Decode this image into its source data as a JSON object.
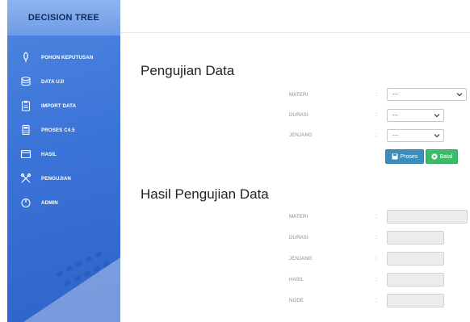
{
  "sidebar": {
    "brand": "DECISION TREE",
    "items": [
      {
        "label": "POHON KEPUTUSAN",
        "icon": "tree-icon"
      },
      {
        "label": "DATA UJI",
        "icon": "database-icon"
      },
      {
        "label": "IMPORT DATA",
        "icon": "clipboard-icon"
      },
      {
        "label": "PROSES C4.5",
        "icon": "calculator-icon"
      },
      {
        "label": "HASIL",
        "icon": "window-icon"
      },
      {
        "label": "PENGUJIAN",
        "icon": "tools-icon"
      },
      {
        "label": "ADMIN",
        "icon": "power-icon"
      }
    ]
  },
  "pengujian": {
    "title": "Pengujian Data",
    "fields": [
      {
        "label": "MATERI",
        "value": "---"
      },
      {
        "label": "DURASI",
        "value": "---"
      },
      {
        "label": "JENJANG",
        "value": "---"
      }
    ],
    "colon": ":",
    "proses_label": "Proses",
    "batal_label": "Batal"
  },
  "hasil": {
    "title": "Hasil Pengujian Data",
    "fields": [
      {
        "label": "MATERI",
        "value": ""
      },
      {
        "label": "DURASI",
        "value": ""
      },
      {
        "label": "JENJANG",
        "value": ""
      },
      {
        "label": "HASIL",
        "value": ""
      },
      {
        "label": "NODE",
        "value": ""
      }
    ],
    "colon": ":"
  },
  "colors": {
    "sidebar": "#3b74d8",
    "proses": "#3c8dbc",
    "batal": "#3dbb6b"
  }
}
